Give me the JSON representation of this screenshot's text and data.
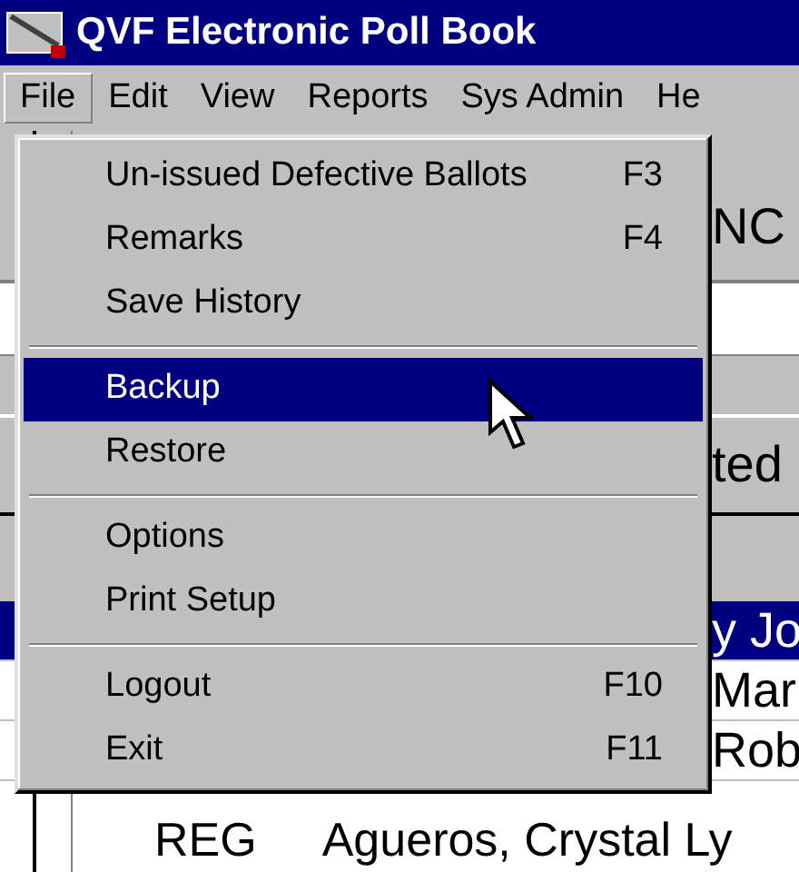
{
  "window": {
    "title": "QVF Electronic Poll Book"
  },
  "menubar": [
    {
      "label": "File",
      "selected": true
    },
    {
      "label": "Edit",
      "selected": false
    },
    {
      "label": "View",
      "selected": false
    },
    {
      "label": "Reports",
      "selected": false
    },
    {
      "label": "Sys Admin",
      "selected": false
    },
    {
      "label": "He",
      "selected": false
    }
  ],
  "file_menu": [
    {
      "kind": "item",
      "label": "Un-issued Defective Ballots",
      "shortcut": "F3",
      "selected": false
    },
    {
      "kind": "item",
      "label": "Remarks",
      "shortcut": "F4",
      "selected": false
    },
    {
      "kind": "item",
      "label": "Save History",
      "selected": false
    },
    {
      "kind": "separator"
    },
    {
      "kind": "item",
      "label": "Backup",
      "selected": true
    },
    {
      "kind": "item",
      "label": "Restore",
      "selected": false
    },
    {
      "kind": "separator"
    },
    {
      "kind": "item",
      "label": "Options",
      "selected": false
    },
    {
      "kind": "item",
      "label": "Print Setup",
      "selected": false
    },
    {
      "kind": "separator"
    },
    {
      "kind": "item",
      "label": "Logout",
      "shortcut": "F10",
      "selected": false
    },
    {
      "kind": "item",
      "label": "Exit",
      "shortcut": "F11",
      "selected": false
    }
  ],
  "background": {
    "header_text": "NC",
    "field_text": "ted",
    "rows": [
      {
        "selected": true,
        "cells": [
          "y Jo"
        ]
      },
      {
        "selected": false,
        "cells": [
          "Mar"
        ]
      },
      {
        "selected": false,
        "cells": [
          "Rob"
        ]
      },
      {
        "selected": false,
        "cells": [
          "REG",
          "Agueros, Crystal Ly"
        ]
      }
    ]
  }
}
